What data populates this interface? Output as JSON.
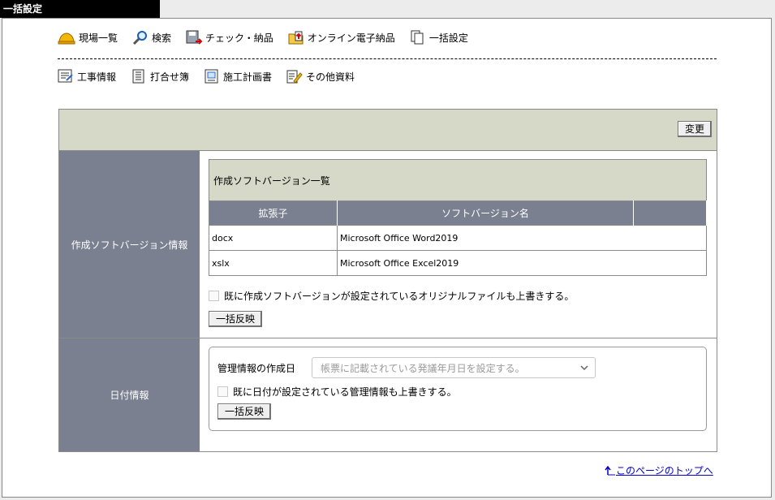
{
  "window": {
    "title": "一括設定"
  },
  "nav": {
    "row1": [
      {
        "label": "現場一覧",
        "icon": "hardhat-icon"
      },
      {
        "label": "検索",
        "icon": "search-icon"
      },
      {
        "label": "チェック・納品",
        "icon": "save-icon"
      },
      {
        "label": "オンライン電子納品",
        "icon": "upload-folder-icon"
      },
      {
        "label": "一括設定",
        "icon": "documents-icon"
      }
    ],
    "row2": [
      {
        "label": "工事情報",
        "icon": "report-icon"
      },
      {
        "label": "打合せ簿",
        "icon": "notebook-icon"
      },
      {
        "label": "施工計画書",
        "icon": "plan-icon"
      },
      {
        "label": "その他資料",
        "icon": "edit-doc-icon"
      }
    ]
  },
  "settings": {
    "change_button": "変更",
    "software": {
      "label": "作成ソフトバージョン情報",
      "table_title": "作成ソフトバージョン一覧",
      "headers": [
        "拡張子",
        "ソフトバージョン名",
        ""
      ],
      "rows": [
        {
          "ext": "docx",
          "name": "Microsoft Office Word2019"
        },
        {
          "ext": "xslx",
          "name": "Microsoft Office Excel2019"
        }
      ],
      "overwrite_label": "既に作成ソフトバージョンが設定されているオリジナルファイルも上書きする。",
      "apply_button": "一括反映"
    },
    "date": {
      "label": "日付情報",
      "field_label": "管理情報の作成日",
      "select_value": "帳票に記載されている発議年月日を設定する。",
      "overwrite_label": "既に日付が設定されている管理情報も上書きする。",
      "apply_button": "一括反映"
    }
  },
  "footer": {
    "top_link": "このページのトップへ"
  }
}
